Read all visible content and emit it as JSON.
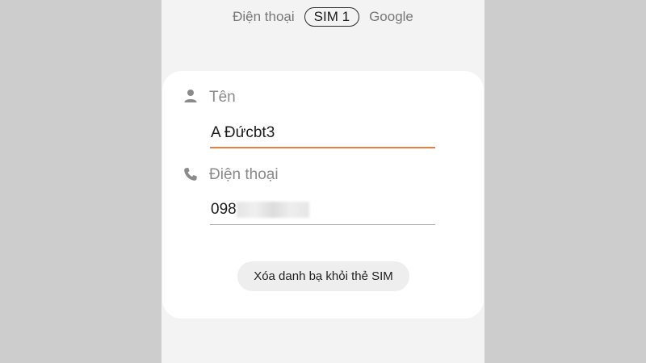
{
  "tabs": [
    {
      "label": "Điện thoại",
      "selected": false
    },
    {
      "label": "SIM 1",
      "selected": true
    },
    {
      "label": "Google",
      "selected": false
    }
  ],
  "contact": {
    "name_label": "Tên",
    "name_value": "A Đứcbt3",
    "name_icon": "person-icon",
    "phone_label": "Điện thoại",
    "phone_value": "098",
    "phone_icon": "phone-icon"
  },
  "actions": {
    "delete_label": "Xóa danh bạ khỏi thẻ SIM"
  },
  "colors": {
    "accent": "#e2803f",
    "background": "#cdcdcd",
    "panel": "#f3f3f3",
    "card": "#ffffff"
  }
}
